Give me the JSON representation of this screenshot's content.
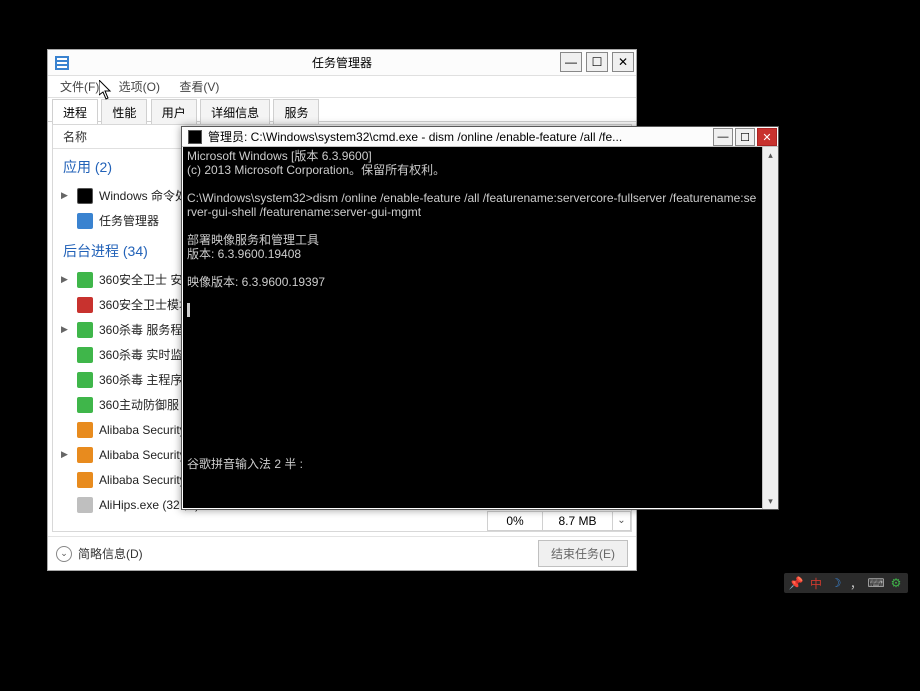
{
  "task_manager": {
    "title": "任务管理器",
    "menubar": {
      "file": "文件(F)",
      "options": "选项(O)",
      "view": "查看(V)"
    },
    "tabs": {
      "processes": "进程",
      "performance": "性能",
      "users": "用户",
      "details": "详细信息",
      "services": "服务"
    },
    "col_name": "名称",
    "group_apps_label": "应用 (2)",
    "group_bg_label": "后台进程 (34)",
    "apps": [
      {
        "name": "Windows 命令处",
        "icon": "cmd",
        "exp": "▶"
      },
      {
        "name": "任务管理器",
        "icon": "tm",
        "exp": ""
      }
    ],
    "bg": [
      {
        "name": "360安全卫士 安装",
        "icon": "360g",
        "exp": "▶"
      },
      {
        "name": "360安全卫士模块",
        "icon": "360r",
        "exp": ""
      },
      {
        "name": "360杀毒 服务程",
        "icon": "360g",
        "exp": "▶"
      },
      {
        "name": "360杀毒 实时监",
        "icon": "360g",
        "exp": ""
      },
      {
        "name": "360杀毒 主程序",
        "icon": "360g",
        "exp": ""
      },
      {
        "name": "360主动防御服",
        "icon": "360g",
        "exp": ""
      },
      {
        "name": "Alibaba Security",
        "icon": "ali",
        "exp": ""
      },
      {
        "name": "Alibaba Security",
        "icon": "ali",
        "exp": "▶"
      },
      {
        "name": "Alibaba Security",
        "icon": "ali",
        "exp": ""
      },
      {
        "name": "AliHips.exe (32 位)",
        "icon": "gen",
        "exp": ""
      }
    ],
    "cpu_cell": "0%",
    "mem_cell": "8.7 MB",
    "fewer_details": "简略信息(D)",
    "end_task": "结束任务(E)"
  },
  "cmd": {
    "title": "管理员: C:\\Windows\\system32\\cmd.exe - dism  /online /enable-feature /all /fe...",
    "l1": "Microsoft Windows [版本 6.3.9600]",
    "l2": "(c) 2013 Microsoft Corporation。保留所有权利。",
    "l3": "",
    "l4": "C:\\Windows\\system32>dism /online /enable-feature /all /featurename:servercore-fullserver /featurename:server-gui-shell /featurename:server-gui-mgmt",
    "l5": "",
    "l6": "部署映像服务和管理工具",
    "l7": "版本: 6.3.9600.19408",
    "l8": "",
    "l9": "映像版本: 6.3.9600.19397",
    "l10": "",
    "ime": "谷歌拼音输入法 2 半 :"
  },
  "tray": {
    "pin": "📌",
    "zh": "中",
    "moon": "☽",
    "comma": "，",
    "kb": "⌨",
    "gear": "⚙"
  }
}
